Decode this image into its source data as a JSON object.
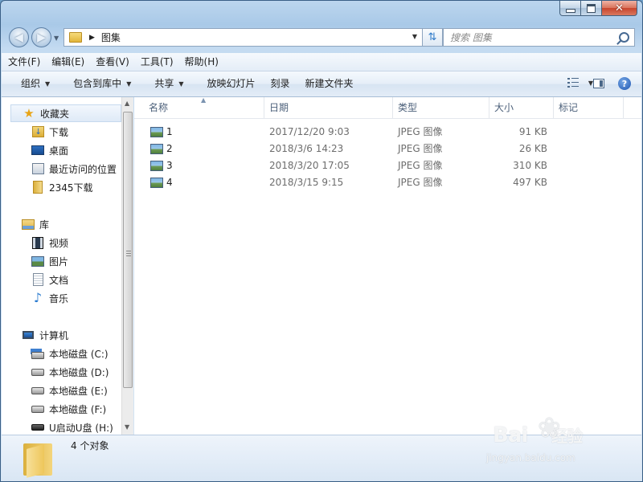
{
  "window": {
    "controls": {
      "minimize": "min",
      "maximize": "max",
      "close": "✕"
    }
  },
  "address": {
    "path": "图集"
  },
  "search": {
    "placeholder": "搜索 图集"
  },
  "menu": [
    "文件(F)",
    "编辑(E)",
    "查看(V)",
    "工具(T)",
    "帮助(H)"
  ],
  "commands": [
    {
      "label": "组织",
      "dropdown": true
    },
    {
      "label": "包含到库中",
      "dropdown": true
    },
    {
      "label": "共享",
      "dropdown": true
    },
    {
      "label": "放映幻灯片",
      "dropdown": false
    },
    {
      "label": "刻录",
      "dropdown": false
    },
    {
      "label": "新建文件夹",
      "dropdown": false
    }
  ],
  "nav": {
    "favorites": {
      "label": "收藏夹",
      "icon": "star-icon",
      "items": [
        {
          "label": "下载",
          "icon": "downloads-icon"
        },
        {
          "label": "桌面",
          "icon": "desktop-icon"
        },
        {
          "label": "最近访问的位置",
          "icon": "recent-places-icon"
        },
        {
          "label": "2345下载",
          "icon": "folder-icon"
        }
      ]
    },
    "libraries": {
      "label": "库",
      "icon": "library-icon",
      "items": [
        {
          "label": "视频",
          "icon": "video-icon"
        },
        {
          "label": "图片",
          "icon": "picture-icon"
        },
        {
          "label": "文档",
          "icon": "document-icon"
        },
        {
          "label": "音乐",
          "icon": "music-icon"
        }
      ]
    },
    "computer": {
      "label": "计算机",
      "icon": "computer-icon",
      "items": [
        {
          "label": "本地磁盘 (C:)",
          "icon": "system-drive-icon"
        },
        {
          "label": "本地磁盘 (D:)",
          "icon": "drive-icon"
        },
        {
          "label": "本地磁盘 (E:)",
          "icon": "drive-icon"
        },
        {
          "label": "本地磁盘 (F:)",
          "icon": "drive-icon"
        },
        {
          "label": "U启动U盘 (H:)",
          "icon": "usb-drive-icon"
        }
      ]
    }
  },
  "columns": [
    "名称",
    "日期",
    "类型",
    "大小",
    "标记"
  ],
  "files": [
    {
      "name": "1",
      "date": "2017/12/20 9:03",
      "type": "JPEG 图像",
      "size": "91 KB"
    },
    {
      "name": "2",
      "date": "2018/3/6 14:23",
      "type": "JPEG 图像",
      "size": "26 KB"
    },
    {
      "name": "3",
      "date": "2018/3/20 17:05",
      "type": "JPEG 图像",
      "size": "310 KB"
    },
    {
      "name": "4",
      "date": "2018/3/15 9:15",
      "type": "JPEG 图像",
      "size": "497 KB"
    }
  ],
  "status": {
    "text": "4 个对象"
  },
  "watermark": {
    "brand": "Bai",
    "brand2": "经验",
    "url": "jingyan.baidu.com"
  }
}
